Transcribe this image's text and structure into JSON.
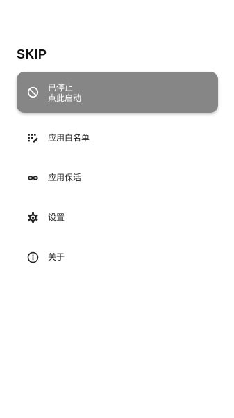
{
  "app": {
    "title": "SKIP"
  },
  "status_card": {
    "line1": "已停止",
    "line2": "点此启动",
    "icon": "block-icon",
    "background": "#868686"
  },
  "menu": [
    {
      "label": "应用白名单",
      "icon": "dialpad-edit-icon"
    },
    {
      "label": "应用保活",
      "icon": "infinity-icon"
    },
    {
      "label": "设置",
      "icon": "gear-icon"
    },
    {
      "label": "关于",
      "icon": "info-icon"
    }
  ]
}
